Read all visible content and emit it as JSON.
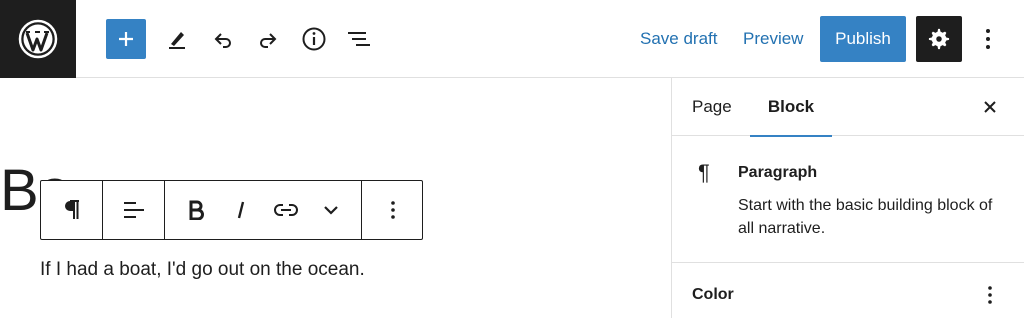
{
  "topbar": {
    "save_draft": "Save draft",
    "preview": "Preview",
    "publish": "Publish",
    "icons": [
      "wordpress-logo",
      "plus-icon",
      "pen-icon",
      "undo-icon",
      "redo-icon",
      "info-icon",
      "list-view-icon",
      "gear-icon",
      "more-vertical-icon"
    ]
  },
  "editor": {
    "title_fragment": "Bo",
    "paragraph": "If I had a boat, I'd go out on the ocean.",
    "block_toolbar_icons": [
      "paragraph-icon",
      "align-icon",
      "bold-icon",
      "italic-icon",
      "link-icon",
      "chevron-down-icon",
      "more-vertical-icon"
    ]
  },
  "sidebar": {
    "tabs": [
      {
        "label": "Page",
        "active": false
      },
      {
        "label": "Block",
        "active": true
      }
    ],
    "block_card": {
      "icon": "¶",
      "title": "Paragraph",
      "description": "Start with the basic building block of all narrative."
    },
    "color_panel": {
      "title": "Color"
    }
  },
  "colors": {
    "accent": "#3582c4",
    "link": "#2271b1",
    "dark": "#1e1e1e",
    "border": "#e0e0e0"
  }
}
